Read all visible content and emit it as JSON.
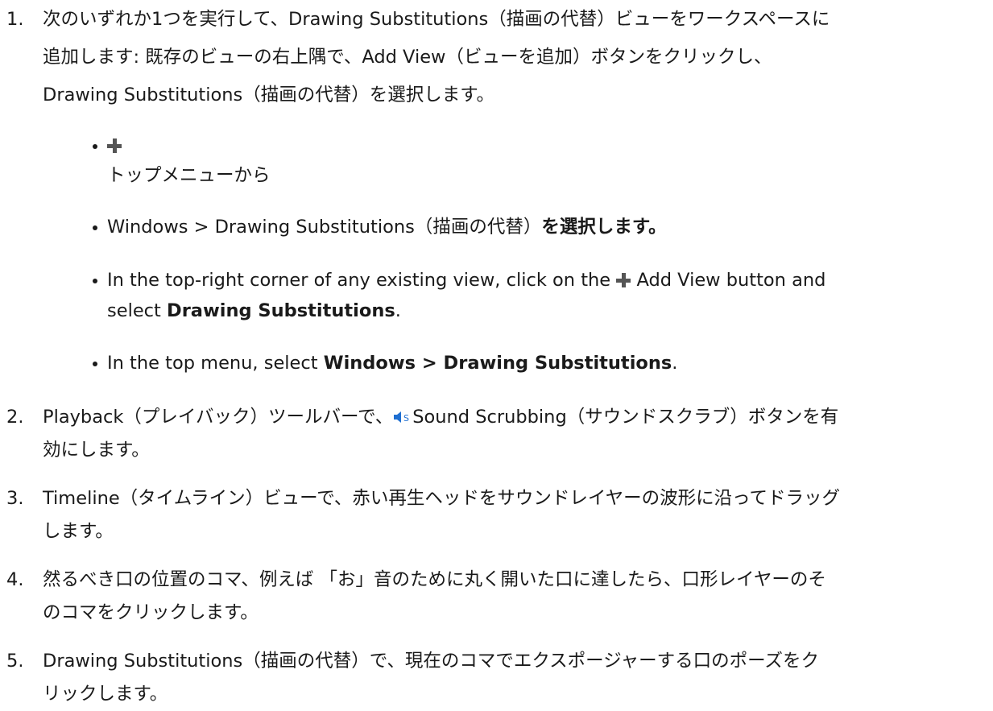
{
  "steps": [
    {
      "number": "1.",
      "lines": [
        "次のいずれか1つを実行して、Drawing Substitutions（描画の代替）ビューをワークスペースに",
        "追加します: 既存のビューの右上隅で、Add View（ビューを追加）ボタンをクリックし、",
        "Drawing Substitutions（描画の代替）を選択します。"
      ],
      "bullets": [
        {
          "icon": "plus-icon",
          "text": "トップメニューから"
        },
        {
          "text": "Windows > Drawing Substitutions（描画の代替）",
          "bold_text": "を選択します。"
        },
        {
          "prefix": "In the top-right corner of any existing view, click on the",
          "icon": "plus-icon",
          "suffix": "Add View button and",
          "line2_prefix": "select ",
          "line2_bold": "Drawing Substitutions",
          "line2_suffix": "."
        },
        {
          "prefix": "In the top menu, select ",
          "bold_text": "Windows > Drawing Substitutions",
          "suffix": "."
        }
      ]
    },
    {
      "number": "2.",
      "line1_prefix": "Playback（プレイバック）ツールバーで、",
      "icon": "sound-scrubbing-icon",
      "line1_suffix": "Sound Scrubbing（サウンドスクラブ）ボタンを有",
      "line2": "効にします。"
    },
    {
      "number": "3.",
      "line1": "Timeline（タイムライン）ビューで、赤い再生ヘッドをサウンドレイヤーの波形に沿ってドラッグ",
      "line2": "します。"
    },
    {
      "number": "4.",
      "line1": "然るべき口の位置のコマ、例えば 「お」音のために丸く開いた口に達したら、口形レイヤーのそ",
      "line2": "のコマをクリックします。"
    },
    {
      "number": "5.",
      "line1": "Drawing Substitutions（描画の代替）で、現在のコマでエクスポージャーする口のポーズをク",
      "line2": "リックします。"
    }
  ],
  "colors": {
    "text": "#1a1a1a",
    "plus_icon": "#555555",
    "sound_icon": "#1f6fd1"
  }
}
